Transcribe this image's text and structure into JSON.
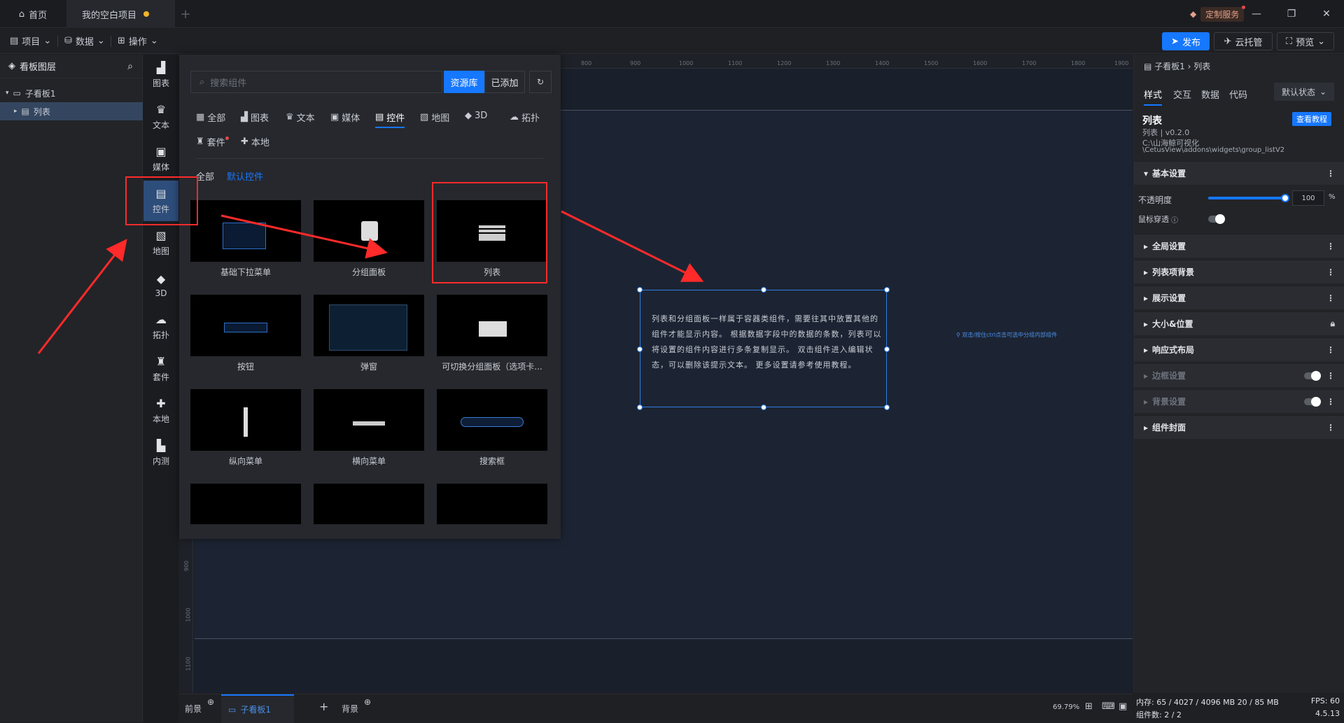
{
  "titlebar": {
    "tabs": [
      {
        "label": "首页"
      },
      {
        "label": "我的空白项目"
      }
    ],
    "custom_service": "定制服务"
  },
  "menubar": {
    "menus": [
      "项目",
      "数据",
      "操作"
    ],
    "publish": "发布",
    "cloud": "云托管",
    "preview": "预览"
  },
  "layers": {
    "title": "看板图层",
    "items": [
      {
        "label": "子看板1"
      },
      {
        "label": "列表"
      }
    ]
  },
  "iconbar": {
    "items": [
      "图表",
      "文本",
      "媒体",
      "控件",
      "地图",
      "3D",
      "拓扑",
      "套件",
      "本地",
      "内测"
    ]
  },
  "panel": {
    "search_placeholder": "搜索组件",
    "btn_library": "资源库",
    "btn_added": "已添加",
    "categories": [
      "全部",
      "图表",
      "文本",
      "媒体",
      "控件",
      "地图",
      "3D",
      "拓扑",
      "套件",
      "本地"
    ],
    "subcategories": [
      "全部",
      "默认控件"
    ],
    "cards": [
      "基础下拉菜单",
      "分组面板",
      "列表",
      "按钮",
      "弹窗",
      "可切换分组面板（选项卡...",
      "纵向菜单",
      "横向菜单",
      "搜索框"
    ]
  },
  "canvas": {
    "ruler_top": [
      "800",
      "900",
      "1000",
      "1100",
      "1200",
      "1300",
      "1400",
      "1500",
      "1600",
      "1700",
      "1800",
      "1900"
    ],
    "ruler_left": [
      "900",
      "1000",
      "1100"
    ],
    "widget_tip": "双击/按住ctrl点击可选中分组内部组件",
    "widget_text": "列表和分组面板一样属于容器类组件，需要往其中放置其他的组件才能显示内容。 根据数据字段中的数据的条数，列表可以将设置的组件内容进行多条复制显示。 双击组件进入编辑状态，可以删除该提示文本。 更多设置请参考使用教程。"
  },
  "props": {
    "breadcrumb": "子看板1 › 列表",
    "tabs": [
      "样式",
      "交互",
      "数据",
      "代码"
    ],
    "state": "默认状态",
    "name": "列表",
    "tutorial": "查看教程",
    "version": "列表 | v0.2.0",
    "path1": "C:\\山海鲸可视化",
    "path2": "\\CetusView\\addons\\widgets\\group_listV2",
    "basic": "基本设置",
    "opacity_label": "不透明度",
    "opacity_value": "100",
    "opacity_unit": "%",
    "opacity_percent": 100,
    "mouse_through": "鼠标穿透",
    "sections": [
      "全局设置",
      "列表项背景",
      "展示设置",
      "大小&位置",
      "响应式布局",
      "边框设置",
      "背景设置",
      "组件封面"
    ]
  },
  "bottom": {
    "front": "前景",
    "board": "子看板1",
    "background": "背景",
    "zoom": "69.79%"
  },
  "status": {
    "memory": "内存:  65 / 4027 / 4096 MB  20 / 85 MB",
    "fps": "FPS:  60",
    "count": "组件数: 2 / 2",
    "version": "4.5.13"
  },
  "colors": {
    "accent": "#1677ff",
    "highlight_red": "#ff2a2a",
    "canvas": "#1a202b"
  }
}
